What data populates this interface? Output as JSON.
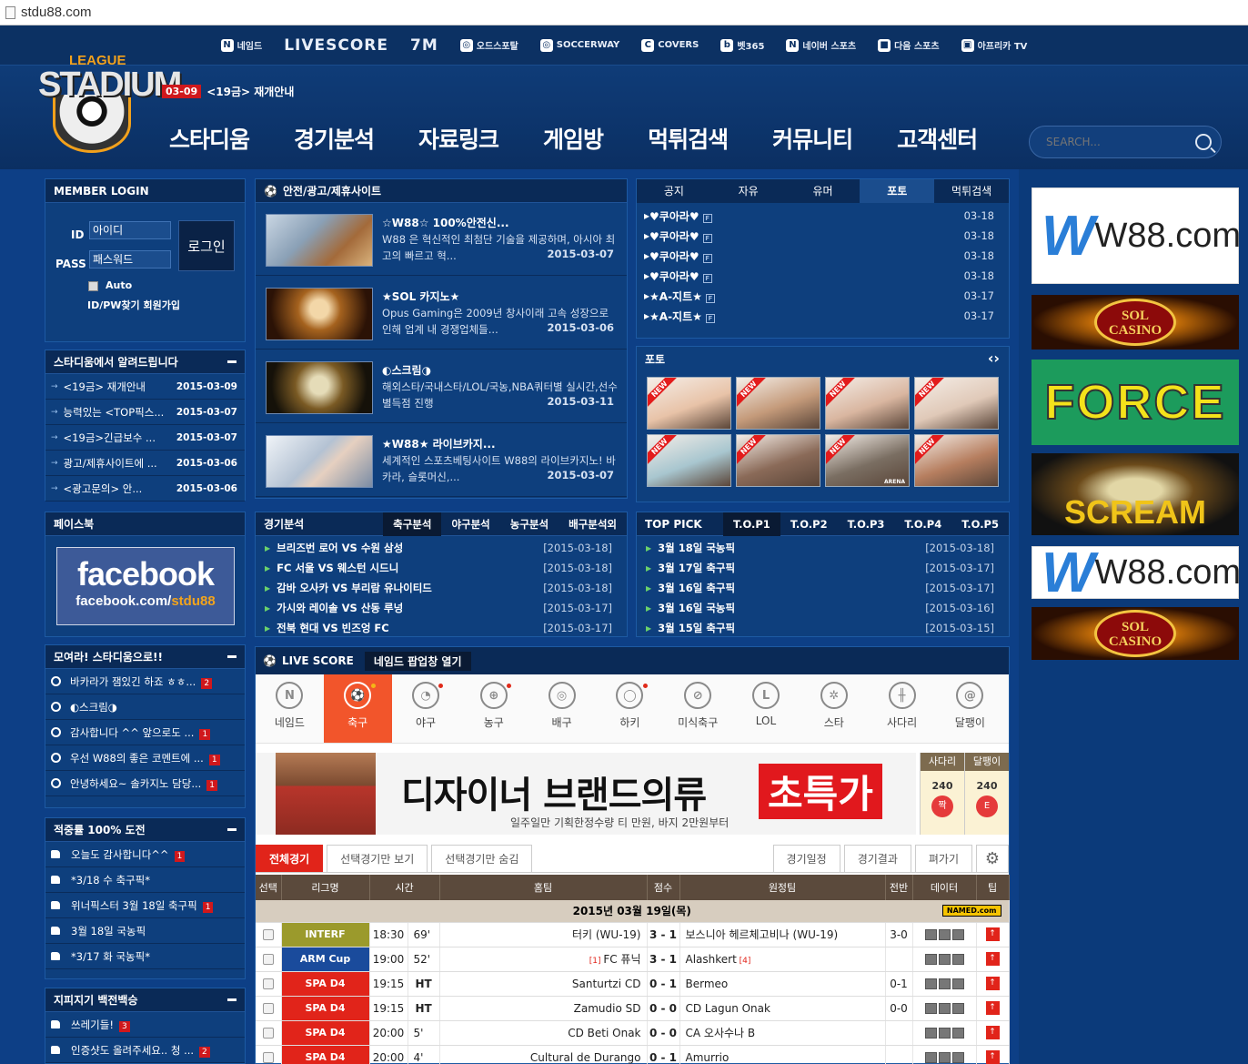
{
  "browser": {
    "url": "stdu88.com"
  },
  "partners": [
    {
      "label": "네임드",
      "icon": "N"
    },
    {
      "label": "LIVESCORE",
      "icon": "",
      "big": true
    },
    {
      "label": "7M",
      "icon": "",
      "big": true
    },
    {
      "label": "오드스포탈",
      "icon": "◎"
    },
    {
      "label": "SOCCERWAY",
      "icon": "◎"
    },
    {
      "label": "COVERS",
      "icon": "C"
    },
    {
      "label": "벳365",
      "icon": "b"
    },
    {
      "label": "네이버 스포츠",
      "icon": "N"
    },
    {
      "label": "다음 스포츠",
      "icon": "■"
    },
    {
      "label": "아프리카 TV",
      "icon": "▣"
    }
  ],
  "logo": {
    "league": "LEAGUE",
    "stadium": "STADIUM"
  },
  "header_notice": {
    "date": "03-09",
    "text": "<19금> 재개안내"
  },
  "mainnav": [
    "스타디움",
    "경기분석",
    "자료링크",
    "게임방",
    "먹튀검색",
    "커뮤니티",
    "고객센터"
  ],
  "search": {
    "placeholder": "SEARCH..."
  },
  "login": {
    "title": "MEMBER LOGIN",
    "id_label": "ID",
    "id_value": "아이디",
    "pass_label": "PASS",
    "pass_value": "패스워드",
    "button": "로그인",
    "auto": "Auto",
    "links": "ID/PW찾기 회원가입"
  },
  "notices": {
    "title": "스타디움에서 알려드립니다",
    "items": [
      {
        "t": "<19금> 재개안내",
        "d": "2015-03-09"
      },
      {
        "t": "능력있는 <TOP픽스...",
        "d": "2015-03-07"
      },
      {
        "t": "<19금>긴급보수 ...",
        "d": "2015-03-07"
      },
      {
        "t": "광고/제휴사이트에 ...",
        "d": "2015-03-06"
      },
      {
        "t": "<광고문의> 안...",
        "d": "2015-03-06"
      }
    ]
  },
  "facebook": {
    "title": "페이스북",
    "logo": "facebook",
    "url_prefix": "facebook.com/",
    "url_user": "stdu88"
  },
  "gather": {
    "title": "모여라! 스타디움으로!!",
    "items": [
      {
        "t": "바카라가 잼있긴 하죠 ㅎㅎ...",
        "c": "2"
      },
      {
        "t": "◐스크림◑",
        "c": ""
      },
      {
        "t": "감사합니다 ^^ 앞으로도 ...",
        "c": "1"
      },
      {
        "t": "우선 W88의 좋은 코멘트에 ...",
        "c": "1"
      },
      {
        "t": "안녕하세요~ 솔카지노 담당...",
        "c": "1"
      }
    ]
  },
  "accuracy": {
    "title": "적중률 100% 도전",
    "items": [
      {
        "t": "오늘도 감사합니다^^",
        "c": "1"
      },
      {
        "t": "*3/18 수 축구픽*",
        "c": ""
      },
      {
        "t": "위너픽스터 3월 18일 축구픽",
        "c": "1"
      },
      {
        "t": "3월 18일 국농픽",
        "c": ""
      },
      {
        "t": "*3/17 화 국농픽*",
        "c": ""
      }
    ]
  },
  "zipizigi": {
    "title": "지피지기 백전백승",
    "items": [
      {
        "t": "쓰레기들!",
        "c": "3"
      },
      {
        "t": "인증샷도 올려주세요.. 청 ...",
        "c": "2"
      }
    ]
  },
  "safe_sites": {
    "title": "안전/광고/제휴사이트",
    "items": [
      {
        "title": "☆W88☆ 100%안전신...",
        "desc": "W88 은 혁신적인 최첨단 기술을 제공하며, 아시아 최고의 빠르고 혁...",
        "date": "2015-03-07"
      },
      {
        "title": "★SOL 카지노★",
        "desc": "Opus Gaming은 2009년 창사이래 고속 성장으로 인해 업계 내 경쟁업체들...",
        "date": "2015-03-06"
      },
      {
        "title": "◐스크림◑",
        "desc": "해외스타/국내스타/LOL/국농,NBA쿼터별 실시간,선수별득점 진행",
        "date": "2015-03-11"
      },
      {
        "title": "★W88★ 라이브카지...",
        "desc": "세계적인 스포츠베팅사이트 W88의 라이브카지노! 바카라, 슬롯머신,...",
        "date": "2015-03-07"
      }
    ]
  },
  "board": {
    "tabs": [
      "공지",
      "자유",
      "유머",
      "포토",
      "먹튀검색"
    ],
    "active": 3,
    "items": [
      {
        "t": "♥쿠아라♥",
        "d": "03-18"
      },
      {
        "t": "♥쿠아라♥",
        "d": "03-18"
      },
      {
        "t": "♥쿠아라♥",
        "d": "03-18"
      },
      {
        "t": "♥쿠아라♥",
        "d": "03-18"
      },
      {
        "t": "★A-지트★",
        "d": "03-17"
      },
      {
        "t": "★A-지트★",
        "d": "03-17"
      }
    ],
    "file_icon": "F"
  },
  "photo": {
    "title": "포토",
    "new_label": "NEW",
    "count": 8,
    "arena": "ARENA"
  },
  "analysis": {
    "title": "경기분석",
    "tabs": [
      "축구분석",
      "야구분석",
      "농구분석",
      "배구분석외"
    ],
    "items": [
      {
        "t": "브리즈번 로어 VS 수원 삼성",
        "d": "[2015-03-18]"
      },
      {
        "t": "FC 서울 VS 웨스턴 시드니",
        "d": "[2015-03-18]"
      },
      {
        "t": "감바 오사카 VS 부리람 유나이티드",
        "d": "[2015-03-18]"
      },
      {
        "t": "가시와 레이솔 VS 산동 루넝",
        "d": "[2015-03-17]"
      },
      {
        "t": "전북 현대 VS 빈즈엉 FC",
        "d": "[2015-03-17]"
      }
    ]
  },
  "toppick": {
    "title": "TOP PICK",
    "tabs": [
      "T.O.P1",
      "T.O.P2",
      "T.O.P3",
      "T.O.P4",
      "T.O.P5"
    ],
    "items": [
      {
        "t": "3월 18일 국농픽",
        "d": "[2015-03-18]"
      },
      {
        "t": "3월 17일 축구픽",
        "d": "[2015-03-17]"
      },
      {
        "t": "3월 16일 축구픽",
        "d": "[2015-03-17]"
      },
      {
        "t": "3월 16일 국농픽",
        "d": "[2015-03-16]"
      },
      {
        "t": "3월 15일 축구픽",
        "d": "[2015-03-15]"
      }
    ]
  },
  "live": {
    "title": "LIVE SCORE",
    "open_label": "네임드 팝업창 열기",
    "sports": [
      {
        "label": "네임드",
        "glyph": "N",
        "dot": ""
      },
      {
        "label": "축구",
        "glyph": "⚽",
        "dot": "y",
        "on": true
      },
      {
        "label": "야구",
        "glyph": "◔",
        "dot": "r"
      },
      {
        "label": "농구",
        "glyph": "⊕",
        "dot": "r"
      },
      {
        "label": "배구",
        "glyph": "◎",
        "dot": ""
      },
      {
        "label": "하키",
        "glyph": "◯",
        "dot": "r"
      },
      {
        "label": "미식축구",
        "glyph": "⊘",
        "dot": ""
      },
      {
        "label": "LOL",
        "glyph": "L",
        "dot": ""
      },
      {
        "label": "스타",
        "glyph": "✲",
        "dot": ""
      },
      {
        "label": "사다리",
        "glyph": "╫",
        "dot": ""
      },
      {
        "label": "달팽이",
        "glyph": "@",
        "dot": ""
      }
    ],
    "ad": {
      "headline": "디자이너 브랜드의류",
      "highlight": "초특가",
      "sub": "일주일만 기획한정수량 티 만원, 바지 2만원부터"
    },
    "mini_games": [
      {
        "title": "사다리",
        "num": "240",
        "chip": "짝"
      },
      {
        "title": "달팽이",
        "num": "240",
        "chip": "E"
      }
    ],
    "game_tabs": [
      "전체경기",
      "선택경기만 보기",
      "선택경기만 숨김"
    ],
    "right_tabs": [
      "경기일정",
      "경기결과",
      "펴가기"
    ],
    "settings_icon": "⚙",
    "columns": [
      "선택",
      "리그명",
      "시간",
      "홈팀",
      "점수",
      "원정팀",
      "전반",
      "데이터",
      "팁"
    ],
    "day": "2015년 03월 19일(목)",
    "named_badge": "NAMED.com",
    "games": [
      {
        "league": "INTERF",
        "lcolor": "#9b9a2c",
        "time": "18:30",
        "min": "69'",
        "home": "터키 (WU-19)",
        "home_red": "",
        "score": "3 - 1",
        "away": "보스니아 헤르체고비나 (WU-19)",
        "away_red": "",
        "half": "3-0"
      },
      {
        "league": "ARM Cup",
        "lcolor": "#1a4b9c",
        "time": "19:00",
        "min": "52'",
        "home": "FC 퓨닉",
        "home_red": "[1]",
        "score": "3 - 1",
        "away": "Alashkert",
        "away_red": "[4]",
        "half": ""
      },
      {
        "league": "SPA D4",
        "lcolor": "#e1241a",
        "time": "19:15",
        "min": "HT",
        "home": "Santurtzi CD",
        "home_red": "",
        "score": "0 - 1",
        "away": "Bermeo",
        "away_red": "",
        "half": "0-1"
      },
      {
        "league": "SPA D4",
        "lcolor": "#e1241a",
        "time": "19:15",
        "min": "HT",
        "home": "Zamudio SD",
        "home_red": "",
        "score": "0 - 0",
        "away": "CD Lagun Onak",
        "away_red": "",
        "half": "0-0"
      },
      {
        "league": "SPA D4",
        "lcolor": "#e1241a",
        "time": "20:00",
        "min": "5'",
        "home": "CD Beti Onak",
        "home_red": "",
        "score": "0 - 0",
        "away": "CA 오사수나 B",
        "away_red": "",
        "half": ""
      },
      {
        "league": "SPA D4",
        "lcolor": "#e1241a",
        "time": "20:00",
        "min": "4'",
        "home": "Cultural de Durango",
        "home_red": "",
        "score": "0 - 1",
        "away": "Amurrio",
        "away_red": "",
        "half": ""
      }
    ]
  },
  "banners": [
    {
      "type": "w88",
      "w": "W",
      "text": "W88.com"
    },
    {
      "type": "sol",
      "text1": "SOL",
      "text2": "CASINO"
    },
    {
      "type": "force",
      "text": "FORCE"
    },
    {
      "type": "scream",
      "text": "SCREAM"
    },
    {
      "type": "w88",
      "w": "W",
      "text": "W88.com"
    },
    {
      "type": "sol",
      "text1": "SOL",
      "text2": "CASINO"
    }
  ]
}
